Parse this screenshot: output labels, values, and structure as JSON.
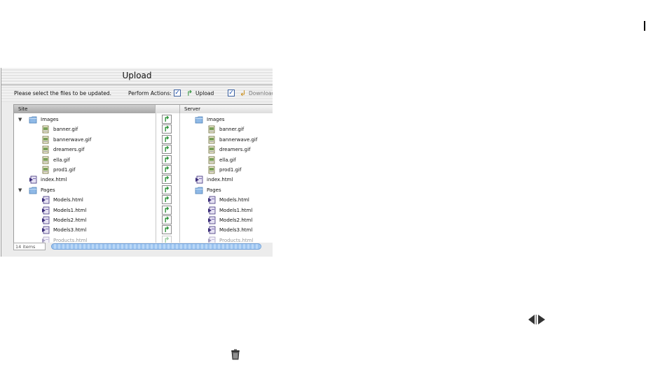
{
  "window": {
    "title": "Upload",
    "prompt": "Please select the files to be updated.",
    "perform_actions_label": "Perform Actions:",
    "upload_checked": "✓",
    "upload_label": "Upload",
    "download_checked": "✓",
    "download_label": "Download"
  },
  "columns": {
    "site": "Site",
    "server": "Server"
  },
  "rows": [
    {
      "name": "Images",
      "type": "folder",
      "expanded": true
    },
    {
      "name": "banner.gif",
      "type": "image"
    },
    {
      "name": "bannerwave.gif",
      "type": "image"
    },
    {
      "name": "dreamers.gif",
      "type": "image"
    },
    {
      "name": "ella.gif",
      "type": "image"
    },
    {
      "name": "prod1.gif",
      "type": "image"
    },
    {
      "name": "index.html",
      "type": "html"
    },
    {
      "name": "Pages",
      "type": "folder",
      "expanded": true
    },
    {
      "name": "Models.html",
      "type": "html"
    },
    {
      "name": "Models1.html",
      "type": "html"
    },
    {
      "name": "Models2.html",
      "type": "html"
    },
    {
      "name": "Models3.html",
      "type": "html"
    },
    {
      "name": "Products.html",
      "type": "html"
    }
  ],
  "status": {
    "items": "14 items"
  },
  "icons": {
    "upload_arrow": "upload-arrow-icon",
    "download_arrow": "download-arrow-icon",
    "folder": "folder-icon",
    "html": "html-file-icon",
    "image": "image-file-icon",
    "nav": "left-right-arrows-icon",
    "trash": "trash-icon"
  },
  "colors": {
    "checkbox": "#1b4fb0",
    "arrow": "#1d8a2a",
    "folder": "#8fb9e6",
    "scroll": "#9cc4f0"
  }
}
